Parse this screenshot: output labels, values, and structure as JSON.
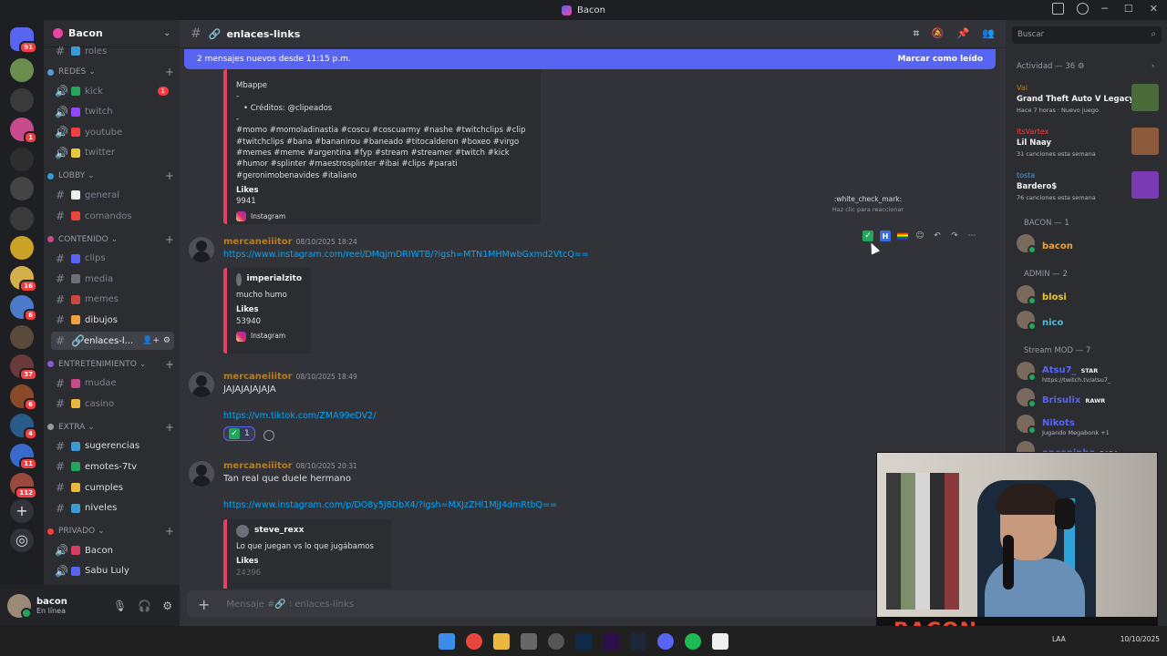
{
  "window": {
    "title": "Bacon"
  },
  "servers": [
    {
      "badge": "91",
      "color": "#5865f2"
    },
    {
      "badge": "",
      "color": "#6b8e4e"
    },
    {
      "badge": "",
      "color": "#3a3a3a"
    },
    {
      "badge": "1",
      "color": "#c74a8c"
    },
    {
      "badge": "",
      "color": "#2e2e2e"
    },
    {
      "badge": "",
      "color": "#444"
    },
    {
      "badge": "",
      "color": "#3a3a3a"
    },
    {
      "badge": "",
      "color": "#c9a227"
    },
    {
      "badge": "16",
      "color": "#d4b04a"
    },
    {
      "badge": "6",
      "color": "#4a7ac9"
    },
    {
      "badge": "",
      "color": "#5a4a3a"
    },
    {
      "badge": "37",
      "color": "#6a3a3a"
    },
    {
      "badge": "6",
      "color": "#8a4a2a"
    },
    {
      "badge": "4",
      "color": "#2a5a8a"
    },
    {
      "badge": "11",
      "color": "#3a6ac9"
    },
    {
      "badge": "112",
      "color": "#9a4a3a"
    }
  ],
  "guild": {
    "name": "Bacon"
  },
  "channel_list": {
    "top_partial": "roles",
    "categories": [
      {
        "name": "REDES",
        "channels": [
          {
            "name": "kick",
            "badge": "1"
          },
          {
            "name": "twitch",
            "badge": ""
          },
          {
            "name": "youtube",
            "badge": ""
          },
          {
            "name": "twitter",
            "badge": ""
          }
        ]
      },
      {
        "name": "LOBBY",
        "channels": [
          {
            "name": "general"
          },
          {
            "name": "comandos"
          }
        ]
      },
      {
        "name": "CONTENIDO",
        "channels": [
          {
            "name": "clips"
          },
          {
            "name": "media"
          },
          {
            "name": "memes"
          },
          {
            "name": "dibujos"
          },
          {
            "name": "enlaces-l..."
          }
        ]
      },
      {
        "name": "ENTRETENIMIENTO",
        "channels": [
          {
            "name": "mudae"
          },
          {
            "name": "casino"
          }
        ]
      },
      {
        "name": "EXTRA",
        "channels": [
          {
            "name": "sugerencias"
          },
          {
            "name": "emotes-7tv"
          },
          {
            "name": "cumples"
          },
          {
            "name": "niveles"
          }
        ]
      },
      {
        "name": "PRIVADO",
        "channels": [
          {
            "name": "Bacon"
          },
          {
            "name": "Sabu Luly"
          }
        ]
      }
    ]
  },
  "user_panel": {
    "name": "bacon",
    "status": "En línea"
  },
  "header": {
    "channel": "enlaces-links",
    "hash": "#"
  },
  "new_messages_bar": {
    "text": "2 mensajes nuevos desde 11:15 p.m.",
    "action": "Marcar como leído"
  },
  "embed_top": {
    "title": "Mbappe",
    "dash1": "-",
    "credits": "Créditos: @clipeados",
    "dash2": "-",
    "hashtags": "#momo #momoladinastia #coscu #coscuarmy #nashe #twitchclips #clip #twitchclips #bana #bananirou #baneado #titocalderon #boxeo #virgo #memes #meme #argentina #fyp #stream #streamer #twitch #kick #humor #splinter #maestrosplinter #ibai #clips #parati #geronimobenavides #italiano",
    "likes_label": "Likes",
    "likes_value": "9941",
    "source": "Instagram"
  },
  "messages": [
    {
      "author": "mercaneiiitor",
      "time": "08/10/2025 18:24",
      "link": "https://www.instagram.com/reel/DMqjmDRIWTB/?igsh=MTN1MHMwbGxmd2VtcQ==",
      "embed": {
        "author": "imperialzito",
        "text": "mucho humo",
        "likes_label": "Likes",
        "likes_value": "53940",
        "source": "Instagram"
      }
    },
    {
      "author": "mercaneiiitor",
      "time": "08/10/2025 18:49",
      "text": "JAJAJAJAJAJA",
      "link": "https://vm.tiktok.com/ZMA99eDV2/",
      "reaction_count": "1"
    },
    {
      "author": "mercaneiiitor",
      "time": "08/10/2025 20:31",
      "text": "Tan real que duele hermano",
      "link": "https://www.instagram.com/p/DO8y5J8DbX4/?igsh=MXJzZHl1MjJ4dmRtbQ==",
      "embed": {
        "author": "steve_rexx",
        "text": "Lo que juegan vs lo que jugábamos",
        "likes_label": "Likes",
        "likes_value": "24396"
      }
    }
  ],
  "tooltip": {
    "emoji": ":white_check_mark:",
    "hint": "Haz clic para reaccionar"
  },
  "composer": {
    "placeholder": "Mensaje #🔗 ⁝ enlaces-links"
  },
  "search": {
    "placeholder": "Buscar"
  },
  "activity": {
    "title": "Actividad — 36",
    "items": [
      {
        "name": "Val",
        "title": "Grand Theft Auto V Legacy",
        "sub": "Hace 7 horas · Nuevo juego",
        "color": "#c27c0e",
        "art": "#4a6a3a"
      },
      {
        "name": "ItsVartex",
        "title": "Lil Naay",
        "sub": "31 canciones esta semana",
        "color": "#f23f43",
        "art": "#8a5a3a"
      },
      {
        "name": "tosta",
        "title": "Bardero$",
        "sub": "76 canciones esta semana",
        "color": "#5a9bd4",
        "art": "#7a3ab4"
      }
    ]
  },
  "members": {
    "groups": [
      {
        "role": "BACON — 1",
        "members": [
          {
            "name": "bacon",
            "color": "#e8a33d",
            "sub": "",
            "tag": ""
          }
        ]
      },
      {
        "role": "ADMIN — 2",
        "members": [
          {
            "name": "blosi",
            "color": "#e8c83d",
            "sub": "",
            "tag": ""
          },
          {
            "name": "nico",
            "color": "#5ab9d4",
            "sub": "",
            "tag": ""
          }
        ]
      },
      {
        "role": "Stream MOD — 7",
        "members": [
          {
            "name": "Atsu7_",
            "color": "#5865f2",
            "sub": "https://twitch.tv/atsu7_",
            "tag": "STAR"
          },
          {
            "name": "Brisulix",
            "color": "#5865f2",
            "sub": "",
            "tag": "RAWR"
          },
          {
            "name": "Nikots",
            "color": "#5865f2",
            "sub": "Jugando Megabonk +1",
            "tag": ""
          },
          {
            "name": "onespinho",
            "color": "#5865f2",
            "sub": "",
            "tag": "BABA"
          }
        ]
      }
    ]
  },
  "webcam": {
    "banner": "BACON"
  },
  "taskbar": {
    "lang": "LAA",
    "date": "10/10/2025"
  }
}
